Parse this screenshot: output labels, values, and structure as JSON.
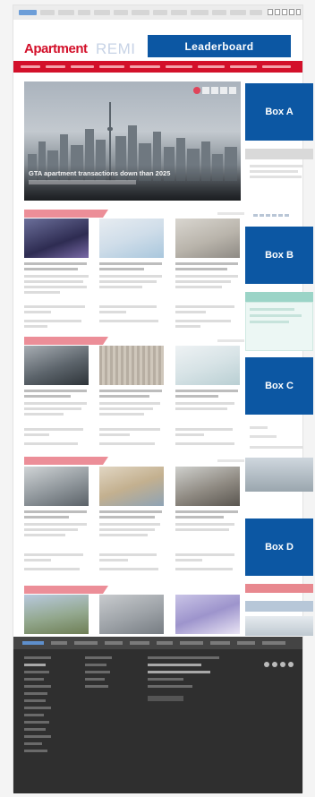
{
  "header": {
    "logo_main": "Apartment",
    "logo_sub": "REMI"
  },
  "ads": {
    "leaderboard": "Leaderboard",
    "box_a": "Box A",
    "box_b": "Box B",
    "box_c": "Box C",
    "box_d": "Box D"
  },
  "hero": {
    "title": "GTA apartment transactions down than 2025",
    "slide_count": 5,
    "active_slide": 1
  },
  "colors": {
    "brand_red": "#d3102a",
    "ad_blue": "#0c57a3",
    "section_label": "#ec8e98",
    "footer_bg": "#2f2f2f"
  },
  "icons": [
    "facebook-icon",
    "twitter-icon",
    "linkedin-icon",
    "instagram-icon",
    "rss-icon"
  ]
}
